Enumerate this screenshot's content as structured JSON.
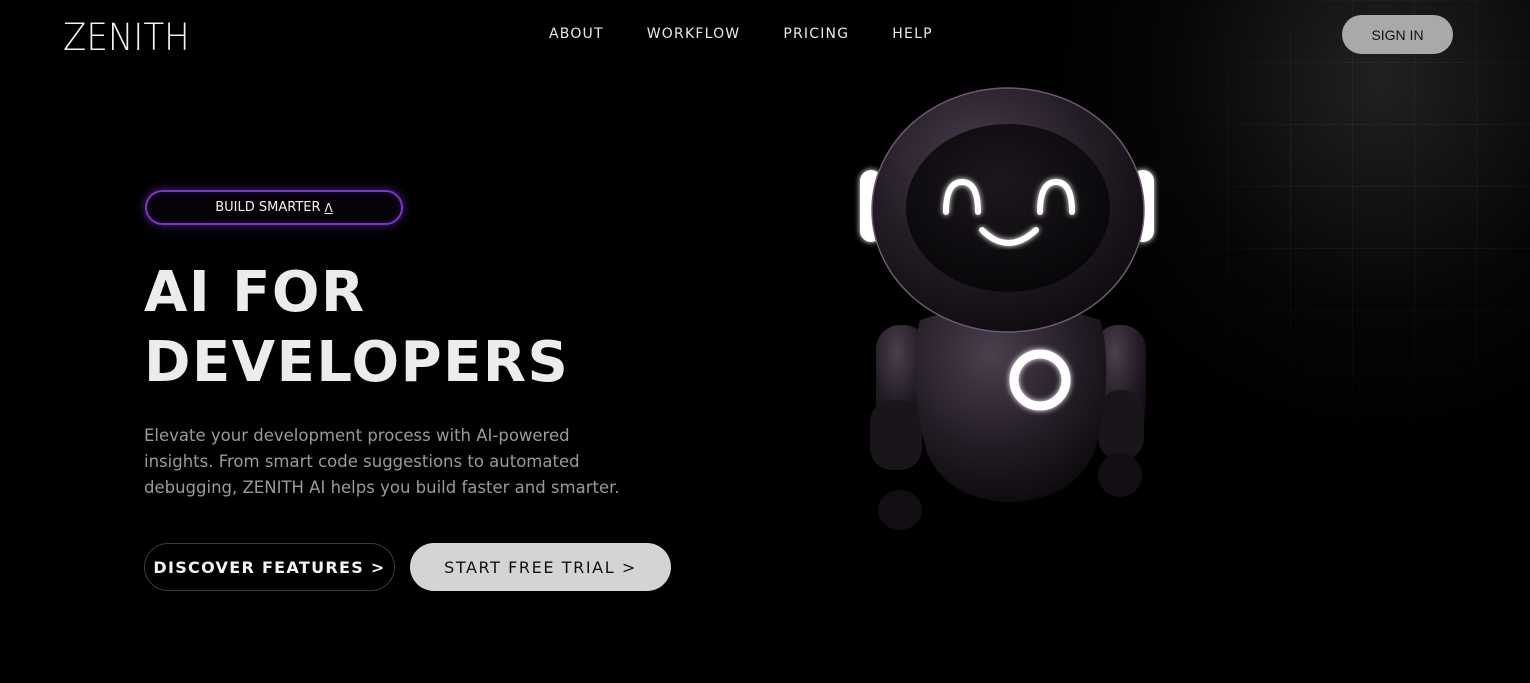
{
  "header": {
    "logo": "ZENITH",
    "nav": [
      "ABOUT",
      "WORKFLOW",
      "PRICING",
      "HELP"
    ],
    "signin_label": "SIGN IN"
  },
  "hero": {
    "badge_label": "BUILD SMARTER",
    "badge_icon": "caret-up-icon",
    "title_line1": "AI FOR",
    "title_line2": "DEVELOPERS",
    "description": "Elevate your development process with AI-powered insights. From smart code suggestions to automated debugging, ZENITH AI helps you build faster and smarter.",
    "primary_button": "DISCOVER FEATURES >",
    "secondary_button": "START FREE TRIAL >"
  },
  "colors": {
    "background": "#000000",
    "accent_purple": "#7a35c9",
    "signin_bg": "#a9a9a9",
    "trial_bg": "#d4d4d4"
  }
}
